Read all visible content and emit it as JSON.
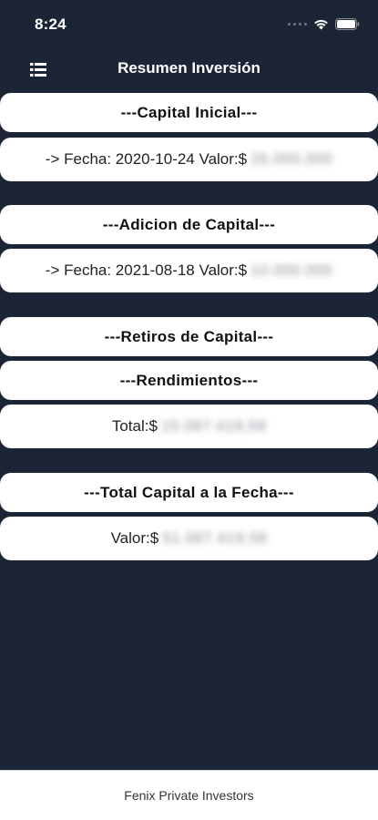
{
  "status_bar": {
    "time": "8:24"
  },
  "nav": {
    "title": "Resumen Inversión",
    "menu_icon": "list-menu-icon"
  },
  "sections": {
    "capital_inicial": {
      "header": "---Capital Inicial---",
      "prefix": "-> Fecha: 2020-10-24 Valor:$",
      "value": "26.000.000"
    },
    "adicion_capital": {
      "header": "---Adicion de Capital---",
      "prefix": "-> Fecha: 2021-08-18 Valor:$",
      "value": "10.000.000"
    },
    "retiros_capital": {
      "header": "---Retiros de Capital---"
    },
    "rendimientos": {
      "header": "---Rendimientos---",
      "prefix": "Total:$",
      "value": "15.087.419,58"
    },
    "total_capital": {
      "header": "---Total Capital a la Fecha---",
      "prefix": "Valor:$",
      "value": "51.087.419,58"
    }
  },
  "footer": {
    "text": "Fenix Private Investors"
  },
  "colors": {
    "background": "#1b2535",
    "card": "#ffffff"
  }
}
